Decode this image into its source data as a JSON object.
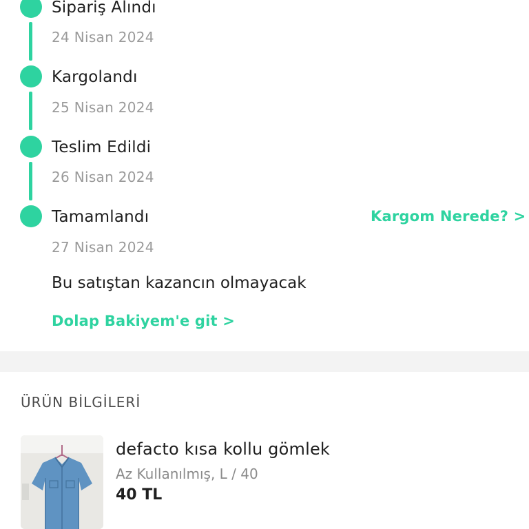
{
  "timeline": {
    "steps": [
      {
        "title": "Sipariş Alındı",
        "date": "24 Nisan 2024"
      },
      {
        "title": "Kargolandı",
        "date": "25 Nisan 2024"
      },
      {
        "title": "Teslim Edildi",
        "date": "26 Nisan 2024"
      },
      {
        "title": "Tamamlandı",
        "date": "27 Nisan 2024"
      }
    ],
    "track_link": "Kargom Nerede? >",
    "earnings_note": "Bu satıştan kazancın olmayacak",
    "balance_link": "Dolap Bakiyem'e git >",
    "accent_color": "#2ed3a0"
  },
  "product": {
    "section_title": "ÜRÜN BİLGİLERİ",
    "name": "defacto kısa kollu gömlek",
    "meta": "Az Kullanılmış, L / 40",
    "price": "40 TL"
  }
}
